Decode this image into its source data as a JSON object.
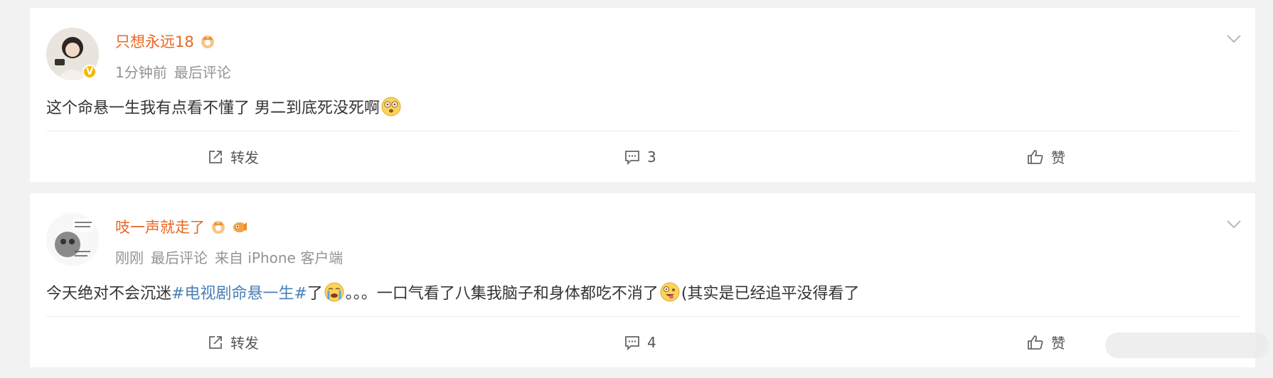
{
  "posts": [
    {
      "username": "只想永远18",
      "time": "1分钟前",
      "tag": "最后评论",
      "source": "",
      "text": "这个命悬一生我有点看不懂了 男二到底死没死啊",
      "actions": {
        "share": "转发",
        "comment": "3",
        "like": "赞"
      }
    },
    {
      "username": "吱一声就走了",
      "time": "刚刚",
      "tag": "最后评论",
      "source": "来自 iPhone 客户端",
      "text_before": "今天绝对不会沉迷",
      "hashtag": "#电视剧命悬一生#",
      "text_after1": " 了",
      "text_after2": "。。。一口气看了八集我脑子和身体都吃不消了",
      "text_after3": "(其实是已经追平没得看了",
      "actions": {
        "share": "转发",
        "comment": "4",
        "like": "赞"
      }
    }
  ],
  "colors": {
    "username": "#e86722",
    "hashtag": "#4a7fb5",
    "meta": "#939393",
    "background": "#f2f2f2"
  },
  "icons": [
    "verified-badge",
    "crown-icon",
    "chevron-down-icon",
    "share-icon",
    "comment-icon",
    "like-icon"
  ]
}
